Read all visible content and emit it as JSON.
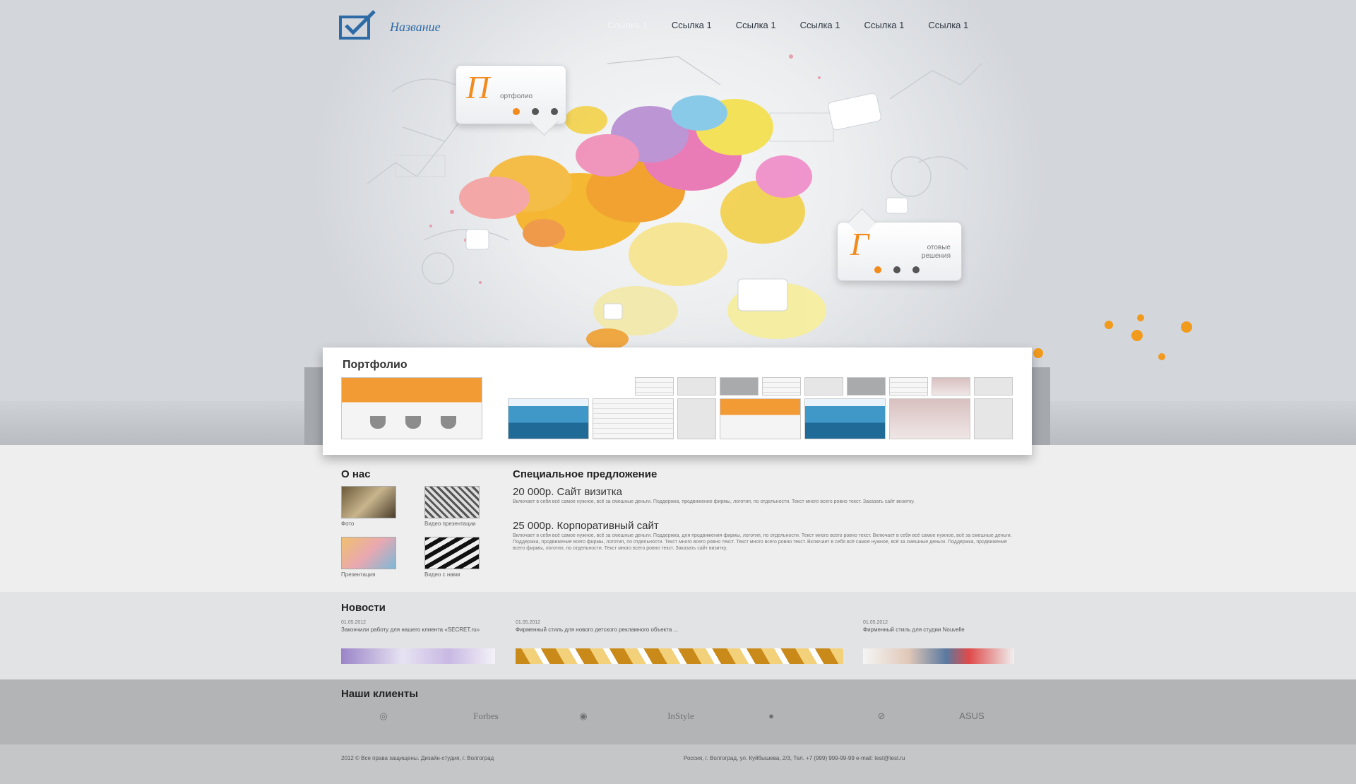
{
  "header": {
    "logo_text": "Название",
    "nav": [
      "Ссылка 1",
      "Ссылка 1",
      "Ссылка 1",
      "Ссылка 1",
      "Ссылка 1",
      "Ссылка 1"
    ]
  },
  "hero": {
    "bubble1": {
      "letter": "П",
      "text": "ортфолио"
    },
    "bubble2": {
      "letter": "Г",
      "text_line1": "отовые",
      "text_line2": "решения"
    }
  },
  "portfolio": {
    "title": "Портфолио"
  },
  "about": {
    "title": "О нас",
    "items": [
      {
        "caption": "Фото"
      },
      {
        "caption": "Видео презентации"
      },
      {
        "caption": "Презентация"
      },
      {
        "caption": "Видео с нами"
      }
    ]
  },
  "offer": {
    "title": "Специальное предложение",
    "items": [
      {
        "head": "20 000р. Сайт визитка",
        "body": "Включает в себя всё самое нужное, всё за смешные деньги. Поддержка, продвижение фирмы, логотип, по отдельности. Текст много всего ровно текст. Заказать сайт визитку."
      },
      {
        "head": "25 000р. Корпоративный сайт",
        "body": "Включает в себя всё самое нужное, всё за смешные деньги. Поддержка, для продвижения фирмы, логотип, по отдельности. Текст много всего ровно текст. Включает в себя всё самое нужное, всё за смешные деньги. Поддержка, продвижение всего фирмы, логотип, по отдельности. Текст много всего ровно текст. Текст много всего ровно текст. Включает в себя всё самое нужное, всё за смешные деньги. Поддержка, продвижение всего фирмы, логотип, по отдельности. Текст много всего ровно текст. Заказать сайт визитку."
      }
    ]
  },
  "news": {
    "title": "Новости",
    "items": [
      {
        "date": "01.05.2012",
        "text": "Закончили работу для нашего клиента «SECRET.ru»"
      },
      {
        "date": "01.05.2012",
        "text": "Фирменный стиль для нового детского рекламного объекта ..."
      },
      {
        "date": "01.05.2012",
        "text": "Фирменный стиль для студии Nouvelle"
      }
    ]
  },
  "clients": {
    "title": "Наши клиенты",
    "items": [
      "◎",
      "Forbes",
      "◉",
      "InStyle",
      "●",
      "⊘",
      "ASUS"
    ]
  },
  "footer": {
    "left": "2012 © Все права защищены. Дизайн-студия, г. Волгоград",
    "right": "Россия, г. Волгоград, ул. Куйбышева, 2/3, Тел. +7 (999) 999-99-99 e-mail: test@test.ru"
  },
  "colors": {
    "accent": "#f28a1c",
    "logo": "#2e6aa6"
  }
}
